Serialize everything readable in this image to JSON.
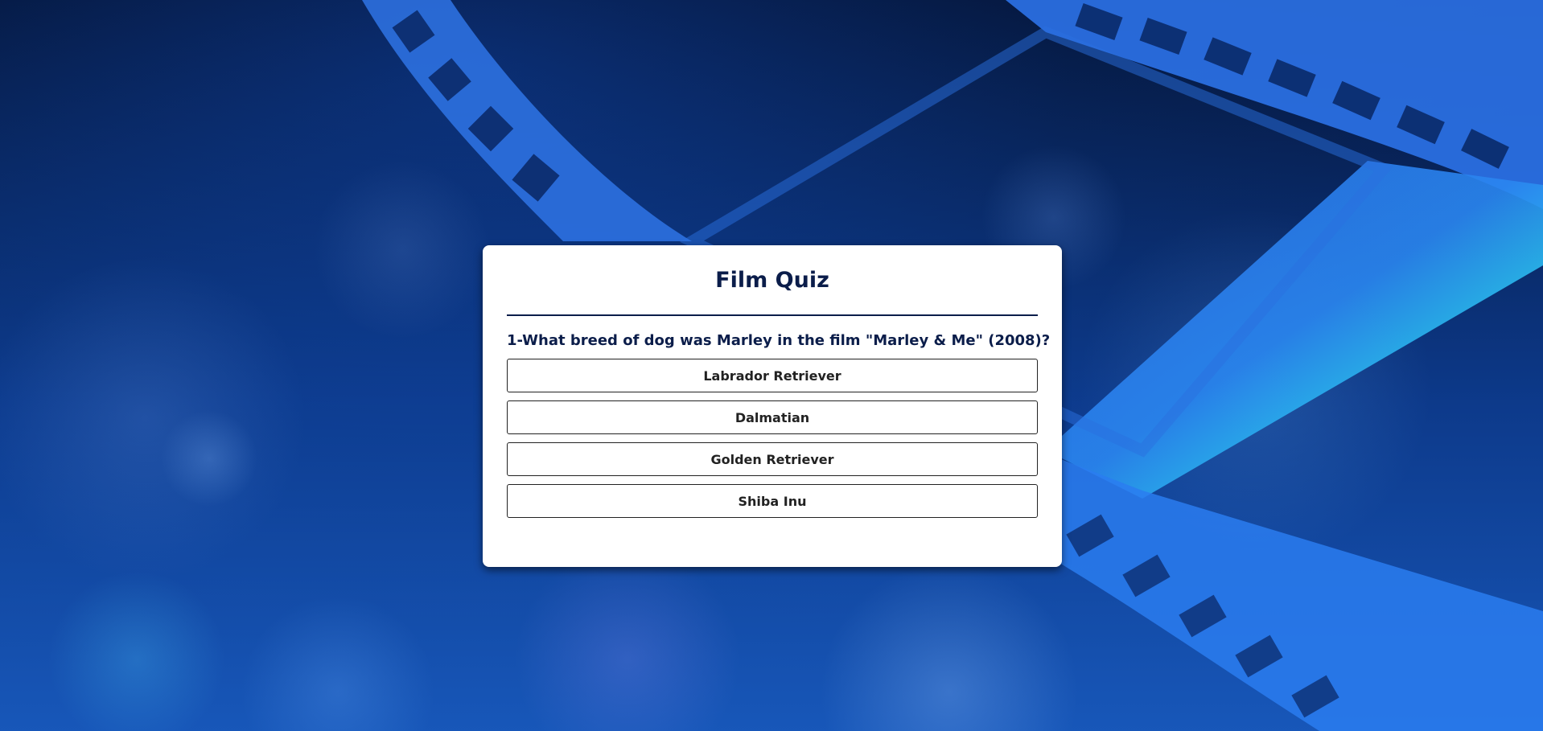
{
  "quiz": {
    "title": "Film Quiz",
    "question": "1-What breed of dog was Marley in the film \"Marley & Me\" (2008)?",
    "answers": [
      {
        "label": "Labrador Retriever"
      },
      {
        "label": "Dalmatian"
      },
      {
        "label": "Golden Retriever"
      },
      {
        "label": "Shiba Inu"
      }
    ]
  },
  "background": {
    "description_icon": "film-strip-icon",
    "colors": {
      "base": "#04163d",
      "film_strip": "#1f6fe8",
      "film_strip_highlight": "#22e0f0"
    }
  },
  "colors": {
    "text_primary": "#0b1d4a",
    "card_background": "#ffffff",
    "button_border": "#222222"
  }
}
